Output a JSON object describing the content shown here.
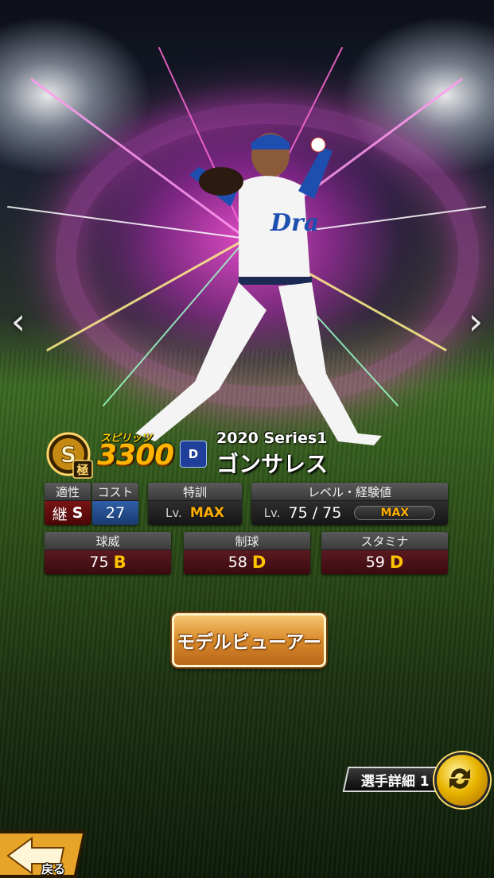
{
  "navigation": {
    "prev_glyph": "‹",
    "next_glyph": "›",
    "prev_icon": "chevron-left-icon",
    "next_icon": "chevron-right-icon"
  },
  "card": {
    "rank_letter": "S",
    "rank_sub": "極",
    "spirits_label": "スピリッツ",
    "spirits_value": "3300",
    "team_logo_text": "D",
    "series": "2020 Series1",
    "player_name": "ゴンサレス"
  },
  "stats_top": {
    "aptitude": {
      "label": "適性",
      "value_char": "継",
      "value_grade": "S"
    },
    "cost": {
      "label": "コスト",
      "value": "27"
    },
    "training": {
      "label": "特訓",
      "lv_prefix": "Lv.",
      "value": "MAX"
    },
    "level": {
      "label": "レベル・経験値",
      "lv_prefix": "Lv.",
      "current": "75",
      "sep": "/",
      "max": "75",
      "exp_label": "MAX"
    }
  },
  "stats_main": [
    {
      "label": "球威",
      "value": "75",
      "grade": "B"
    },
    {
      "label": "制球",
      "value": "58",
      "grade": "D"
    },
    {
      "label": "スタミナ",
      "value": "59",
      "grade": "D"
    }
  ],
  "buttons": {
    "model_viewer": "モデルビューアー",
    "player_detail": "選手詳細 1",
    "back": "戻る"
  },
  "colors": {
    "accent_gold": "#ffb400",
    "grade_gold": "#ffc400",
    "max_orange": "#ffae00",
    "stat_red": "#7a1414",
    "team_blue": "#1f3f9a"
  }
}
